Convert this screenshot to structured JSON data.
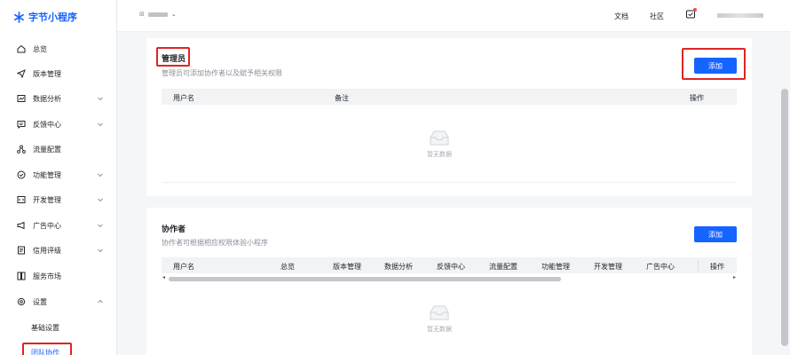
{
  "app": {
    "name": "字节小程序"
  },
  "sidebar": {
    "items": [
      {
        "label": "总览",
        "icon": "home-icon",
        "has_chevron": false
      },
      {
        "label": "版本管理",
        "icon": "send-icon",
        "has_chevron": false
      },
      {
        "label": "数据分析",
        "icon": "chart-icon",
        "has_chevron": true
      },
      {
        "label": "反馈中心",
        "icon": "message-icon",
        "has_chevron": true
      },
      {
        "label": "流量配置",
        "icon": "share-icon",
        "has_chevron": false
      },
      {
        "label": "功能管理",
        "icon": "settings-circle-icon",
        "has_chevron": true
      },
      {
        "label": "开发管理",
        "icon": "code-icon",
        "has_chevron": true
      },
      {
        "label": "广告中心",
        "icon": "megaphone-icon",
        "has_chevron": true
      },
      {
        "label": "信用评级",
        "icon": "clipboard-icon",
        "has_chevron": true
      },
      {
        "label": "服务市场",
        "icon": "store-icon",
        "has_chevron": false
      },
      {
        "label": "设置",
        "icon": "gear-icon",
        "has_chevron": true
      }
    ],
    "sub_items": [
      {
        "label": "基础设置",
        "active": false
      },
      {
        "label": "团队协作",
        "active": true
      }
    ]
  },
  "topbar": {
    "docs": "文档",
    "community": "社区"
  },
  "admin_card": {
    "title": "管理员",
    "desc": "管理员可添加协作者以及赋予相关权限",
    "add_label": "添加",
    "columns": [
      "用户名",
      "备注",
      "操作"
    ],
    "empty_text": "暂无数据"
  },
  "collab_card": {
    "title": "协作者",
    "desc": "协作者可根据相应权限体验小程序",
    "add_label": "添加",
    "columns": [
      "用户名",
      "总览",
      "版本管理",
      "数据分析",
      "反馈中心",
      "流量配置",
      "功能管理",
      "开发管理",
      "广告中心",
      "操作"
    ],
    "empty_text": "暂无数据"
  },
  "colors": {
    "accent": "#1664ff",
    "highlight": "#e02424"
  }
}
